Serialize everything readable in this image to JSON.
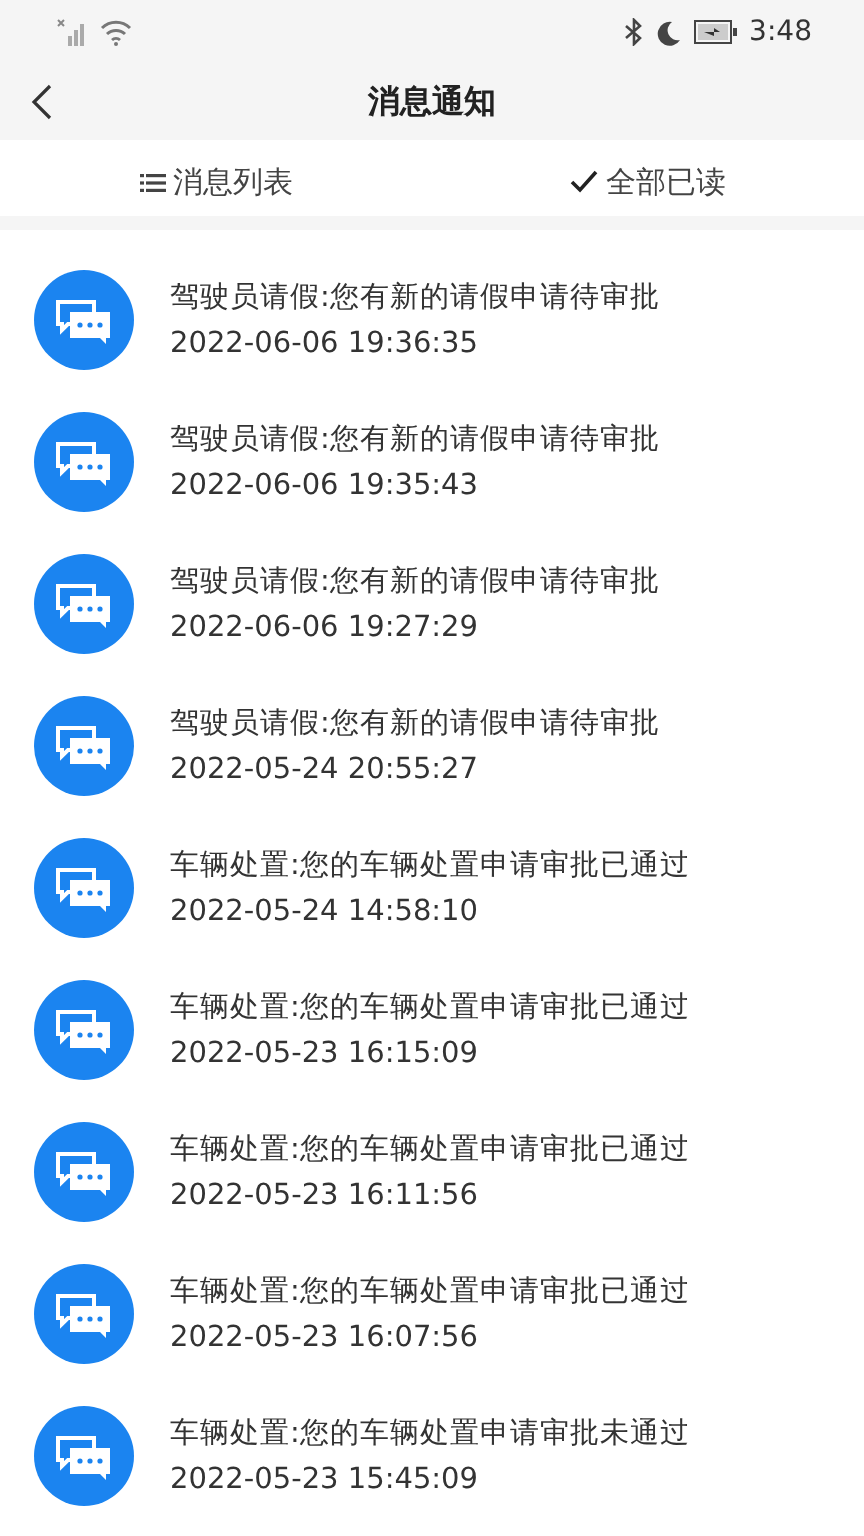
{
  "status_bar": {
    "time": "3:48"
  },
  "header": {
    "title": "消息通知"
  },
  "actions": [
    {
      "kind": "list",
      "label": "消息列表"
    },
    {
      "kind": "check",
      "label": "全部已读"
    }
  ],
  "messages": [
    {
      "title": "驾驶员请假:您有新的请假申请待审批",
      "time": "2022-06-06 19:36:35"
    },
    {
      "title": "驾驶员请假:您有新的请假申请待审批",
      "time": "2022-06-06 19:35:43"
    },
    {
      "title": "驾驶员请假:您有新的请假申请待审批",
      "time": "2022-06-06 19:27:29"
    },
    {
      "title": "驾驶员请假:您有新的请假申请待审批",
      "time": "2022-05-24 20:55:27"
    },
    {
      "title": "车辆处置:您的车辆处置申请审批已通过",
      "time": "2022-05-24 14:58:10"
    },
    {
      "title": "车辆处置:您的车辆处置申请审批已通过",
      "time": "2022-05-23 16:15:09"
    },
    {
      "title": "车辆处置:您的车辆处置申请审批已通过",
      "time": "2022-05-23 16:11:56"
    },
    {
      "title": "车辆处置:您的车辆处置申请审批已通过",
      "time": "2022-05-23 16:07:56"
    },
    {
      "title": "车辆处置:您的车辆处置申请审批未通过",
      "time": "2022-05-23 15:45:09"
    }
  ]
}
